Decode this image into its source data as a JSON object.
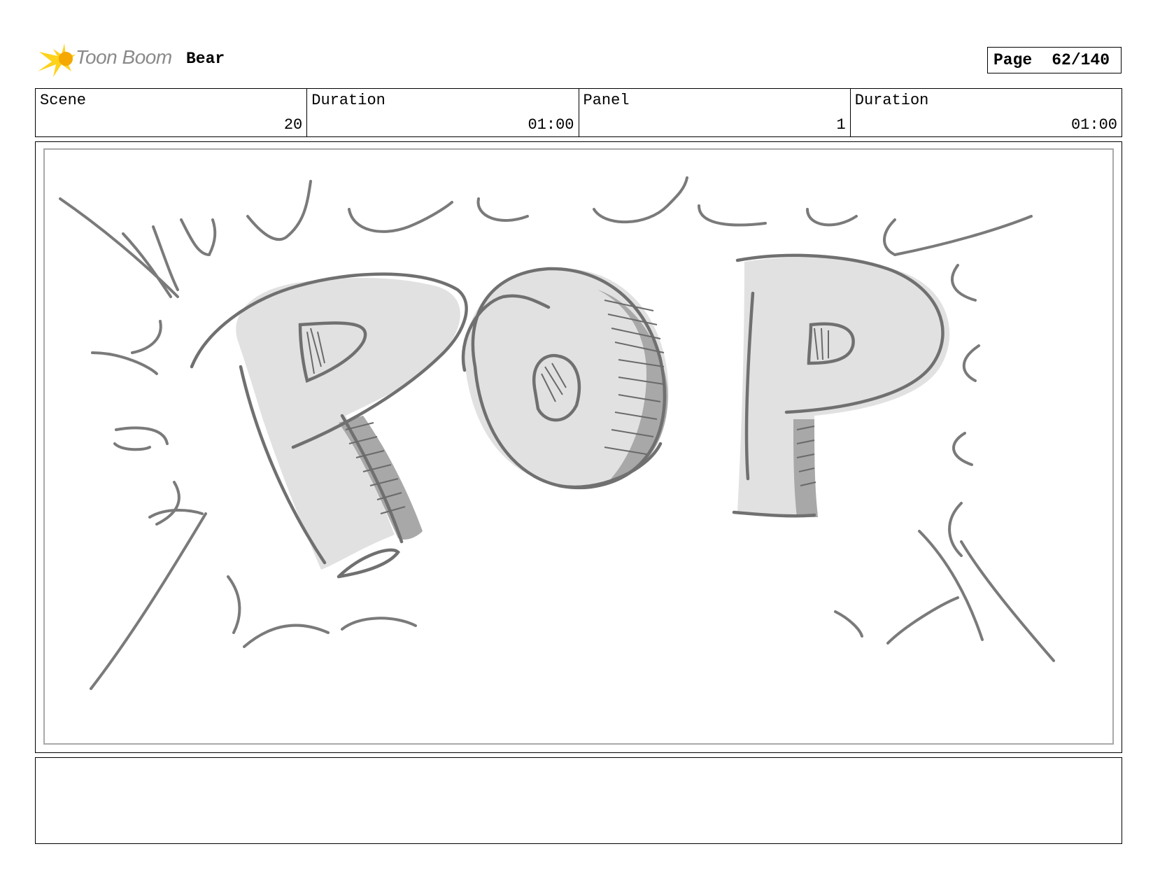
{
  "header": {
    "logo_text": "Toon Boom",
    "project_title": "Bear",
    "page_label": "Page",
    "page_number": "62/140"
  },
  "info": {
    "scene_label": "Scene",
    "scene_value": "20",
    "scene_duration_label": "Duration",
    "scene_duration_value": "01:00",
    "panel_label": "Panel",
    "panel_value": "1",
    "panel_duration_label": "Duration",
    "panel_duration_value": "01:00"
  },
  "panel_art": {
    "lettering": "POP",
    "colors": {
      "stroke": "#737373",
      "fill": "#e1e1e1",
      "shade": "#a8a8a8"
    }
  },
  "notes": {
    "text": ""
  },
  "colors": {
    "logo_orange": "#f5a800",
    "logo_yellow": "#ffd21c",
    "logo_gray": "#8a8a8a",
    "border": "#000000",
    "panel_frame": "#a9a9a9"
  }
}
